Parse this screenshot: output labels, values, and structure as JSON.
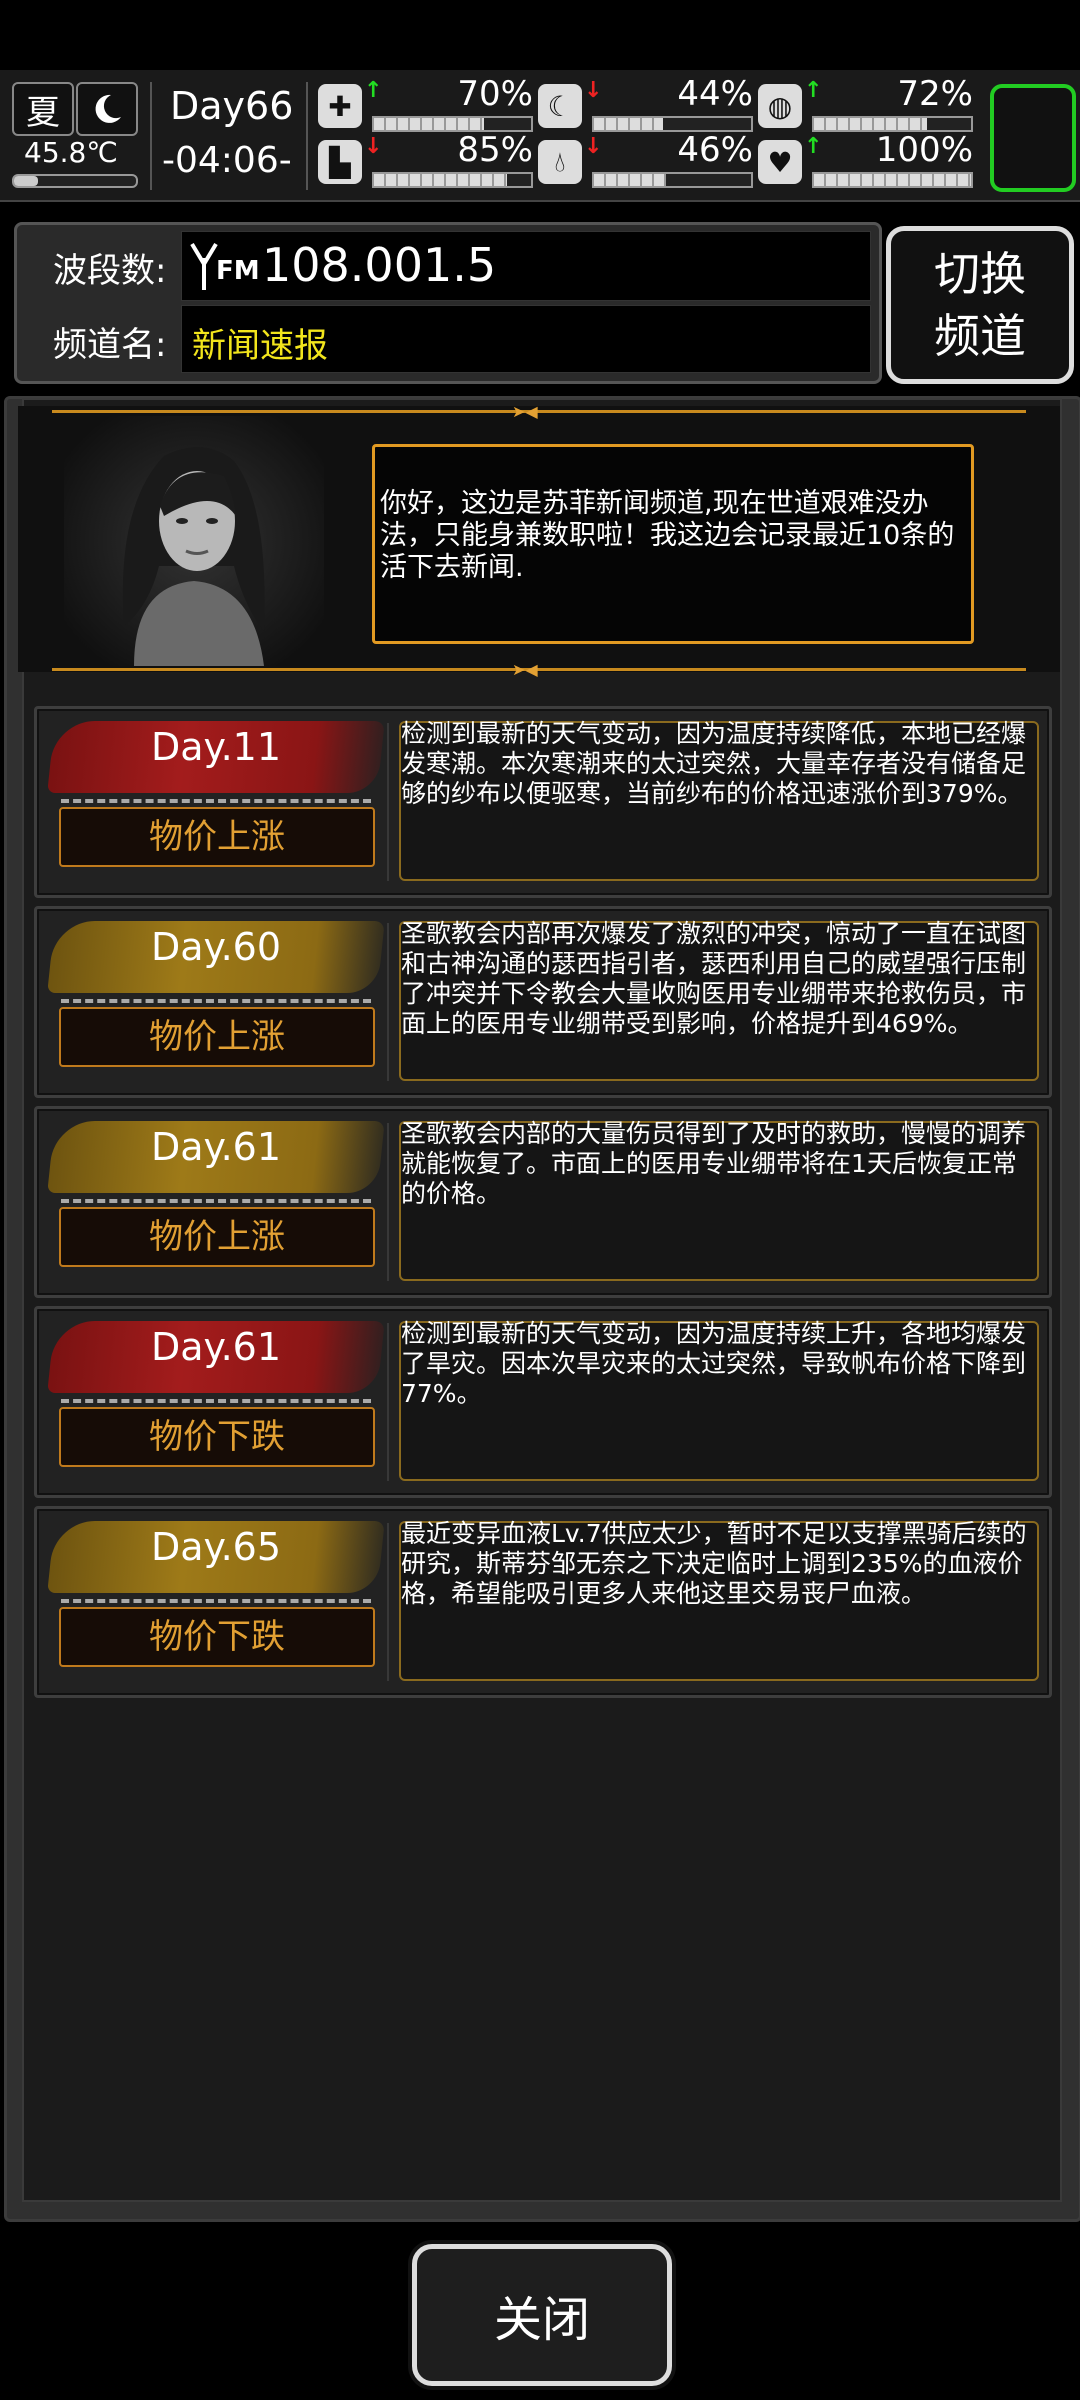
{
  "status": {
    "season": "夏",
    "temperature": "45.8℃",
    "day": "Day66",
    "time": "-04:06-",
    "stats": [
      {
        "icon": "medkit-icon",
        "trend": "up",
        "value": "70%",
        "level": 0.7
      },
      {
        "icon": "stomach-icon",
        "trend": "down",
        "value": "44%",
        "level": 0.44
      },
      {
        "icon": "spirit-icon",
        "trend": "up",
        "value": "72%",
        "level": 0.72
      },
      {
        "icon": "boot-icon",
        "trend": "down",
        "value": "85%",
        "level": 0.85
      },
      {
        "icon": "water-drop-icon",
        "trend": "down",
        "value": "46%",
        "level": 0.46
      },
      {
        "icon": "heart-icon",
        "trend": "up",
        "value": "100%",
        "level": 1.0
      }
    ]
  },
  "radio": {
    "band_label": "波段数:",
    "fm_label": "FM",
    "frequency": "108.001.5",
    "channel_label": "频道名:",
    "channel_name": "新闻速报",
    "switch_line1": "切换",
    "switch_line2": "频道"
  },
  "intro": {
    "text": "你好，这边是苏菲新闻频道,现在世道艰难没办法，只能身兼数职啦！我这边会记录最近10条的活下去新闻."
  },
  "news": [
    {
      "day": "Day.11",
      "tag": "物价上涨",
      "color": "red",
      "text": "检测到最新的天气变动，因为温度持续降低，本地已经爆发寒潮。本次寒潮来的太过突然，大量幸存者没有储备足够的纱布以便驱寒，当前纱布的价格迅速涨价到379%。"
    },
    {
      "day": "Day.60",
      "tag": "物价上涨",
      "color": "gold",
      "text": "圣歌教会内部再次爆发了激烈的冲突，惊动了一直在试图和古神沟通的瑟西指引者，瑟西利用自己的威望强行压制了冲突并下令教会大量收购医用专业绷带来抢救伤员，市面上的医用专业绷带受到影响，价格提升到469%。"
    },
    {
      "day": "Day.61",
      "tag": "物价上涨",
      "color": "gold",
      "text": "圣歌教会内部的大量伤员得到了及时的救助，慢慢的调养就能恢复了。市面上的医用专业绷带将在1天后恢复正常的价格。"
    },
    {
      "day": "Day.61",
      "tag": "物价下跌",
      "color": "red",
      "text": "检测到最新的天气变动，因为温度持续上升，各地均爆发了旱灾。因本次旱灾来的太过突然，导致帆布价格下降到77%。"
    },
    {
      "day": "Day.65",
      "tag": "物价下跌",
      "color": "gold",
      "text": "最近变异血液Lv.7供应太少，暂时不足以支撑黑骑后续的研究，斯蒂芬邹无奈之下决定临时上调到235%的血液价格，希望能吸引更多人来他这里交易丧尸血液。"
    }
  ],
  "close_label": "关闭",
  "colors": {
    "accent_gold": "#e2a033",
    "bag_green": "#22cc22",
    "up": "#22dd22",
    "down": "#ee2222"
  }
}
